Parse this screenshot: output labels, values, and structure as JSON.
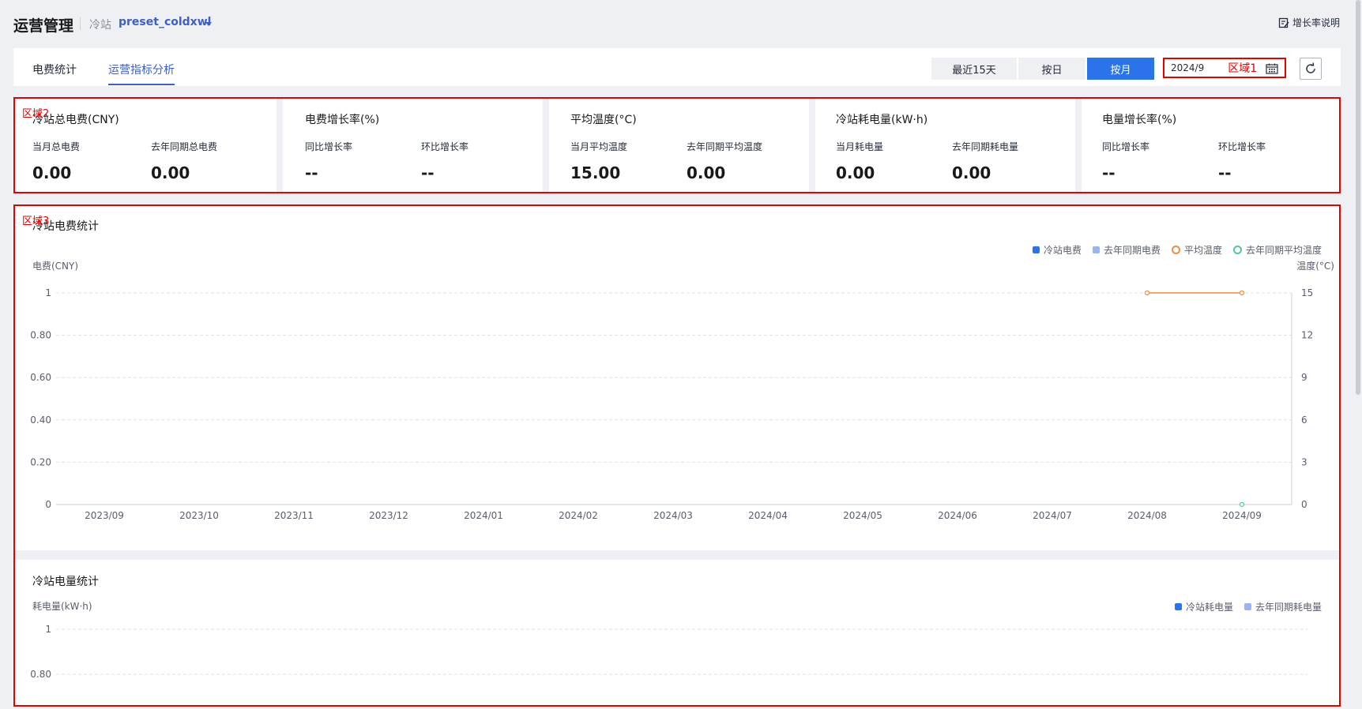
{
  "header": {
    "title": "运营管理",
    "station_label": "冷站",
    "station_name": "preset_coldxwl",
    "help_label": "增长率说明"
  },
  "tabs": [
    {
      "label": "电费统计",
      "active": false
    },
    {
      "label": "运营指标分析",
      "active": true
    }
  ],
  "filters": {
    "segments": [
      {
        "label": "最近15天",
        "active": false
      },
      {
        "label": "按日",
        "active": false
      },
      {
        "label": "按月",
        "active": true
      }
    ],
    "date_value": "2024/9",
    "zone_label": "区域1"
  },
  "zones": {
    "zone2": "区域2",
    "zone3": "区域3"
  },
  "cards": [
    {
      "title": "冷站总电费(CNY)",
      "metrics": [
        {
          "label": "当月总电费",
          "value": "0.00"
        },
        {
          "label": "去年同期总电费",
          "value": "0.00"
        }
      ]
    },
    {
      "title": "电费增长率(%)",
      "metrics": [
        {
          "label": "同比增长率",
          "value": "--"
        },
        {
          "label": "环比增长率",
          "value": "--"
        }
      ]
    },
    {
      "title": "平均温度(°C)",
      "metrics": [
        {
          "label": "当月平均温度",
          "value": "15.00"
        },
        {
          "label": "去年同期平均温度",
          "value": "0.00"
        }
      ]
    },
    {
      "title": "冷站耗电量(kW·h)",
      "metrics": [
        {
          "label": "当月耗电量",
          "value": "0.00"
        },
        {
          "label": "去年同期耗电量",
          "value": "0.00"
        }
      ]
    },
    {
      "title": "电量增长率(%)",
      "metrics": [
        {
          "label": "同比增长率",
          "value": "--"
        },
        {
          "label": "环比增长率",
          "value": "--"
        }
      ]
    }
  ],
  "colors": {
    "accent": "#3e5ec8",
    "primary_btn": "#2b73e8",
    "zone_border": "#e60000",
    "series_cost": "#2b73e8",
    "series_cost_last": "#9db4f2",
    "series_temp": "#f28b3c",
    "series_temp_last": "#4cc9a0"
  },
  "chart_data": [
    {
      "type": "bar",
      "title": "冷站电费统计",
      "ylabel": "电费(CNY)",
      "y2label": "温度(°C)",
      "categories": [
        "2023/09",
        "2023/10",
        "2023/11",
        "2023/12",
        "2024/01",
        "2024/02",
        "2024/03",
        "2024/04",
        "2024/05",
        "2024/06",
        "2024/07",
        "2024/08",
        "2024/09"
      ],
      "ylim": [
        0,
        1
      ],
      "yticks": [
        "0",
        "0.20",
        "0.40",
        "0.60",
        "0.80",
        "1"
      ],
      "y2lim": [
        0,
        15
      ],
      "y2ticks": [
        "0",
        "3",
        "6",
        "9",
        "12",
        "15"
      ],
      "grid": true,
      "legend": "top-right",
      "series": [
        {
          "name": "冷站电费",
          "kind": "bar",
          "axis": "left",
          "values": [
            0,
            0,
            0,
            0,
            0,
            0,
            0,
            0,
            0,
            0,
            0,
            0,
            0
          ]
        },
        {
          "name": "去年同期电费",
          "kind": "bar",
          "axis": "left",
          "values": [
            0,
            0,
            0,
            0,
            0,
            0,
            0,
            0,
            0,
            0,
            0,
            0,
            0
          ]
        },
        {
          "name": "平均温度",
          "kind": "line",
          "axis": "right",
          "values": [
            null,
            null,
            null,
            null,
            null,
            null,
            null,
            null,
            null,
            null,
            null,
            15,
            15
          ]
        },
        {
          "name": "去年同期平均温度",
          "kind": "line",
          "axis": "right",
          "values": [
            null,
            null,
            null,
            null,
            null,
            null,
            null,
            null,
            null,
            null,
            null,
            null,
            0
          ]
        }
      ]
    },
    {
      "type": "bar",
      "title": "冷站电量统计",
      "ylabel": "耗电量(kW·h)",
      "ylim": [
        0,
        1
      ],
      "yticks": [
        "0.80",
        "1"
      ],
      "grid": true,
      "legend": "top-right",
      "series": [
        {
          "name": "冷站耗电量",
          "kind": "bar"
        },
        {
          "name": "去年同期耗电量",
          "kind": "bar"
        }
      ]
    }
  ]
}
